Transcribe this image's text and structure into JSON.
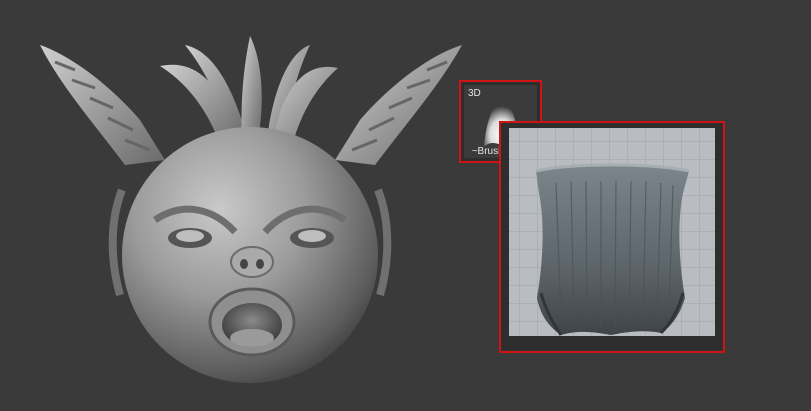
{
  "sculpt_model": {
    "name": "monster-head-sculpt"
  },
  "brush_alpha_thumbnail": {
    "tag": "3D",
    "label": "~BrushAlpha"
  },
  "brush_preview": {
    "name": "brush-alpha-preview"
  },
  "colors": {
    "background": "#3a3a3a",
    "highlight_border": "#d01414",
    "grid_panel": "#b9bcc0",
    "sculpt_gray": "#9a9a9a"
  }
}
